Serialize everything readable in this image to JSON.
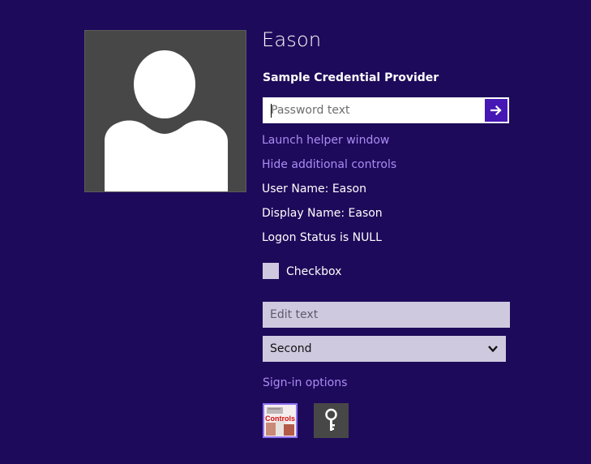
{
  "user": {
    "name": "Eason",
    "avatar_icon": "user-silhouette-icon"
  },
  "credential": {
    "provider_title": "Sample Credential Provider",
    "password_placeholder": "Password text",
    "submit_icon": "arrow-right-icon",
    "launch_helper_label": "Launch helper window",
    "hide_controls_label": "Hide additional controls",
    "user_name_text": "User Name: Eason",
    "display_name_text": "Display Name: Eason",
    "logon_status_text": "Logon Status is NULL",
    "checkbox_label": "Checkbox",
    "checkbox_checked": false,
    "edit_text_placeholder": "Edit text",
    "combo_selected": "Second",
    "signin_options_label": "Sign-in options"
  },
  "signin_tiles": [
    {
      "label": "Controls",
      "icon": "controls-tile-icon",
      "selected": true
    },
    {
      "label": "",
      "icon": "key-icon",
      "selected": false
    }
  ],
  "colors": {
    "background": "#1e0a5a",
    "accent": "#4617b4",
    "link": "#a98cf5",
    "field": "#cfc9df",
    "avatar_bg": "#474747"
  }
}
